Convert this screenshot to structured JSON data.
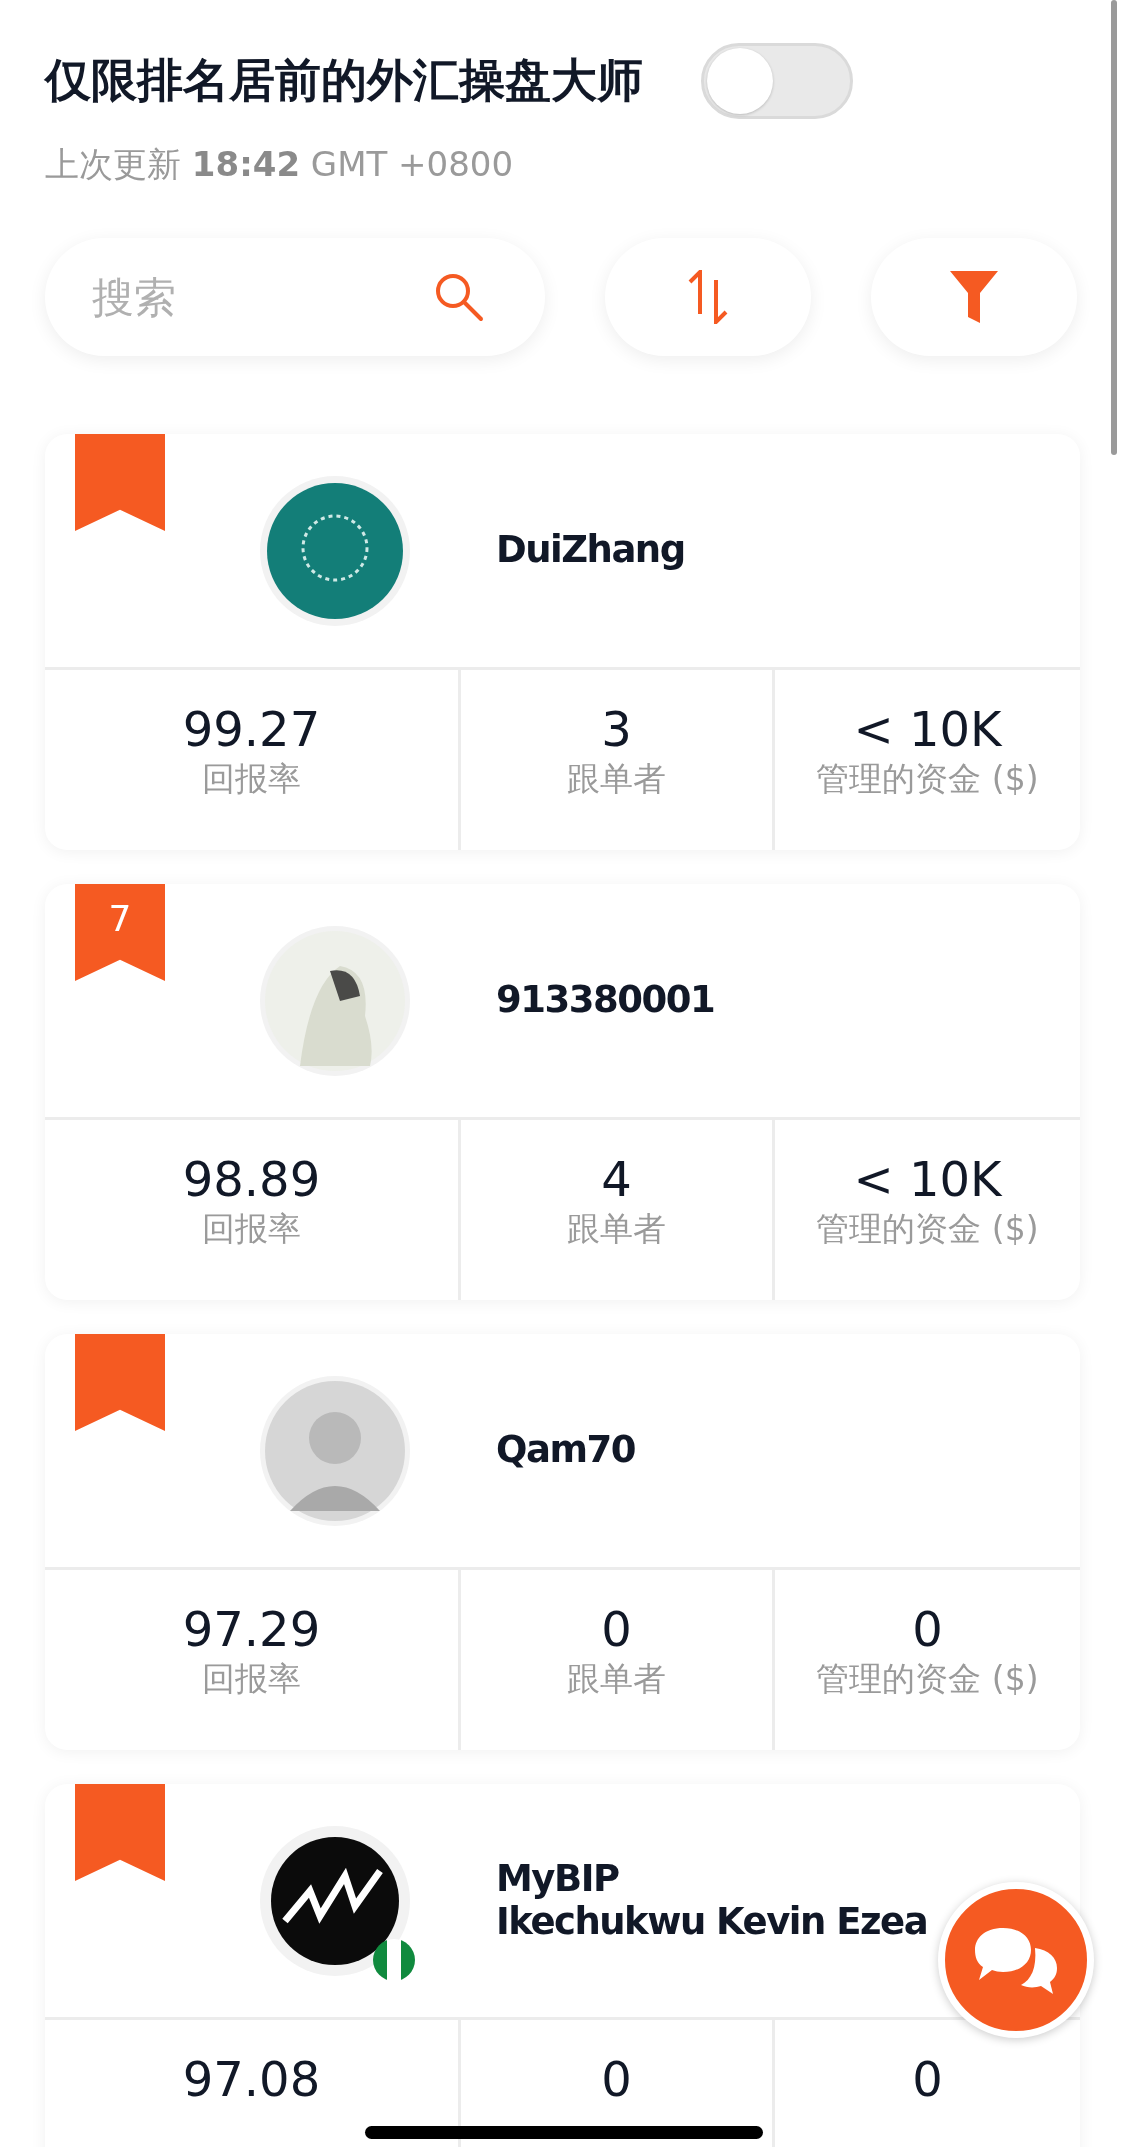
{
  "header": {
    "title": "仅限排名居前的外汇操盘大师",
    "toggle": {
      "on": false
    },
    "last_updated": "上次更新 **18:42** GMT +0800"
  },
  "search": {
    "placeholder": "搜索"
  },
  "traders": [
    {
      "names": [
        "DuiZhang"
      ],
      "flag": false,
      "stats": [
        {
          "value": "99.27",
          "label": "回报率"
        },
        {
          "value": "3",
          "label": "跟单者"
        },
        {
          "value": "< 10K",
          "label": "管理的资金 ($)"
        }
      ]
    },
    {
      "rank": "7",
      "names": [
        "913380001"
      ],
      "flag": false,
      "stats": [
        {
          "value": "98.89",
          "label": "回报率"
        },
        {
          "value": "4",
          "label": "跟单者"
        },
        {
          "value": "< 10K",
          "label": "管理的资金 ($)"
        }
      ]
    },
    {
      "names": [
        "Qam70"
      ],
      "flag": false,
      "stats": [
        {
          "value": "97.29",
          "label": "回报率"
        },
        {
          "value": "0",
          "label": "跟单者"
        },
        {
          "value": "0",
          "label": "管理的资金 ($)"
        }
      ]
    },
    {
      "names": [
        "MyBIP",
        "Ikechukwu Kevin Ezea"
      ],
      "flag": true,
      "stats": [
        {
          "value": "97.08"
        },
        {
          "value": "0"
        },
        {
          "value": "0"
        }
      ]
    }
  ]
}
